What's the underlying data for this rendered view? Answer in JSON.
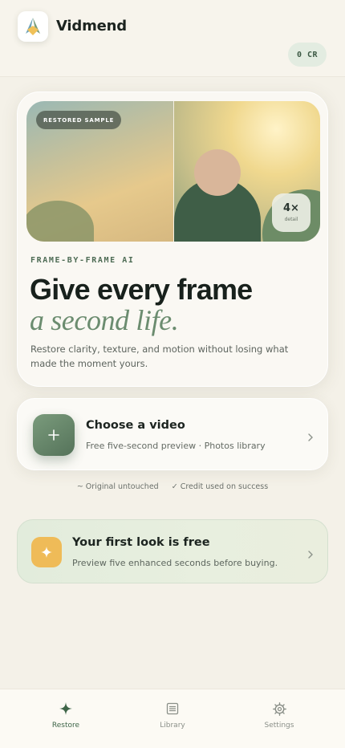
{
  "app": {
    "name": "Vidmend",
    "logo_icon": "vidmend-logo-icon"
  },
  "header": {
    "credits": "0 CR"
  },
  "hero": {
    "sample_badge": "RESTORED SAMPLE",
    "zoom_value": "4×",
    "zoom_label": "detail",
    "eyebrow": "FRAME-BY-FRAME AI",
    "headline": "Give every frame",
    "headline_accent": "a second life.",
    "description": "Restore clarity, texture, and motion without losing what made the moment yours."
  },
  "choose_video": {
    "title": "Choose a video",
    "subtitle": "Free five-second preview · Photos library",
    "icon": "plus-icon"
  },
  "assurances": [
    {
      "text": "~ Original untouched"
    },
    {
      "text": "✓ Credit used on success"
    }
  ],
  "free_look": {
    "title": "Your first look is free",
    "subtitle": "Preview five enhanced seconds before buying.",
    "icon": "sparkle-icon"
  },
  "tabs": [
    {
      "label": "Restore",
      "icon": "sparkle-icon",
      "active": true
    },
    {
      "label": "Library",
      "icon": "library-icon",
      "active": false
    },
    {
      "label": "Settings",
      "icon": "gear-icon",
      "active": false
    }
  ],
  "colors": {
    "accent": "#55735a",
    "accent_light": "#6b8c6f",
    "warm": "#efbb58",
    "background": "#f4f1e8"
  }
}
